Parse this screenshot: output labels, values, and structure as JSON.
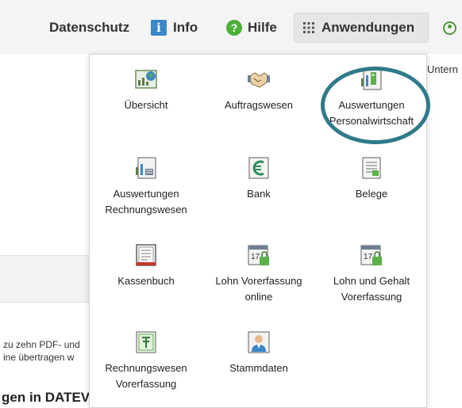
{
  "header": {
    "datenschutz": "Datenschutz",
    "info": "Info",
    "info_icon_char": "i",
    "hilfe": "Hilfe",
    "help_icon_char": "?",
    "anwendungen": "Anwendungen"
  },
  "background": {
    "right_text": "Untern",
    "text_line1": "zu zehn PDF- und",
    "text_line2": "ine übertragen w",
    "heading": "gen in DATEV"
  },
  "apps": [
    {
      "label": "Übersicht",
      "icon": "overview-icon"
    },
    {
      "label": "Auftragswesen",
      "icon": "handshake-icon"
    },
    {
      "label_line1": "Auswertungen",
      "label_line2": "Personalwirtschaft",
      "icon": "chart-report-icon"
    },
    {
      "label_line1": "Auswertungen",
      "label_line2": "Rechnungswesen",
      "icon": "chart-report-icon"
    },
    {
      "label": "Bank",
      "icon": "euro-icon"
    },
    {
      "label": "Belege",
      "icon": "receipt-icon"
    },
    {
      "label": "Kassenbuch",
      "icon": "cashbook-icon"
    },
    {
      "label_line1": "Lohn Vorerfassung",
      "label_line2": "online",
      "icon": "calendar-lock-icon"
    },
    {
      "label_line1": "Lohn und Gehalt",
      "label_line2": "Vorerfassung",
      "icon": "calendar-lock-icon"
    },
    {
      "label_line1": "Rechnungswesen",
      "label_line2": "Vorerfassung",
      "icon": "ledger-icon"
    },
    {
      "label": "Stammdaten",
      "icon": "person-icon"
    }
  ],
  "calendar_number": "17",
  "colors": {
    "highlight": "#2f7a8a",
    "green": "#4caf3a",
    "blue": "#3d86c6"
  }
}
